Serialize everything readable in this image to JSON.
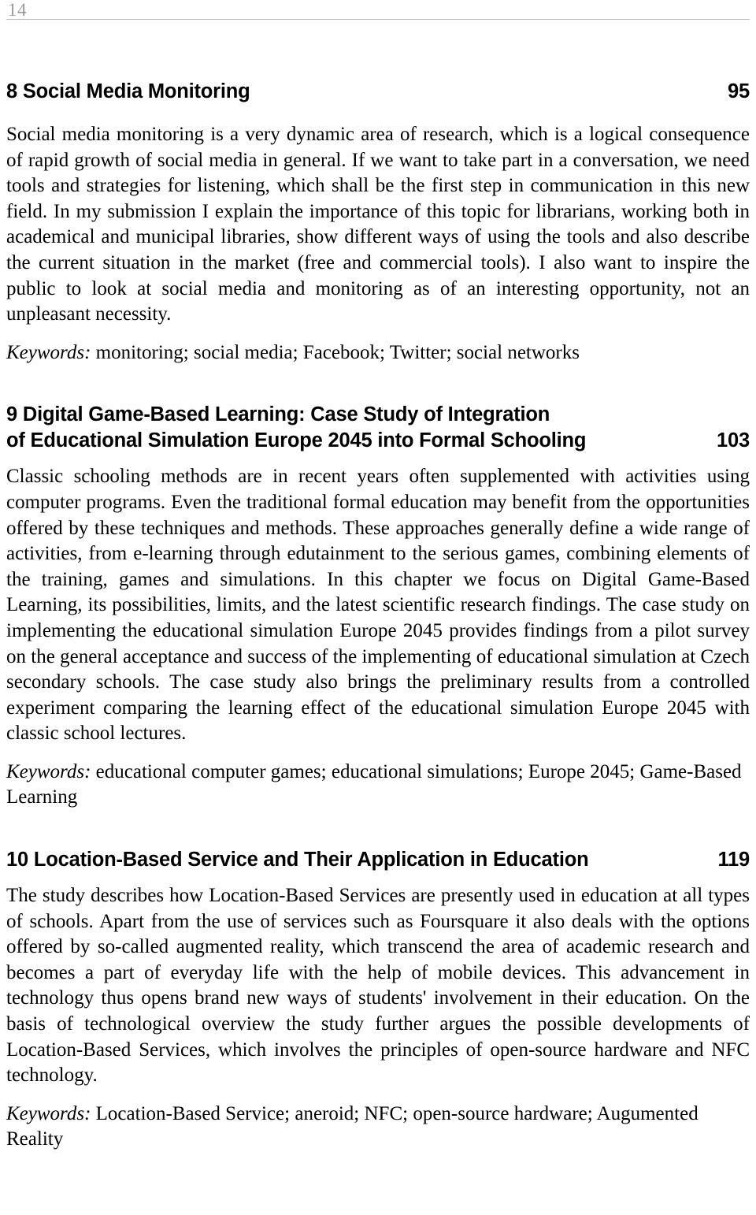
{
  "header": {
    "folio": "14"
  },
  "entries": [
    {
      "id": "social-media-monitoring",
      "number": "8",
      "title_lines": [
        "8 Social Media Monitoring"
      ],
      "page": "95",
      "abstract": "Social media monitoring is a very dynamic area of research, which is a logical consequence of rapid growth of social media in general. If we want to take part in a conversation, we need tools and strategies for listening, which shall be the first step in communication in this new field. In my submission I explain the importance of this topic for librarians, working both in academical and municipal libraries, show different ways of using the tools and also describe the current situation in the market (free and commercial tools). I also want to inspire the public to look at social media and monitoring as of an interesting opportunity, not an unpleasant necessity.",
      "keywords_label": "Keywords:",
      "keywords_text": " monitoring; social media; Facebook; Twitter; social networks"
    },
    {
      "id": "digital-game-based-learning",
      "number": "9",
      "title_lines": [
        "9 Digital Game-Based Learning: Case Study of Integration",
        "of Educational Simulation Europe 2045 into Formal Schooling"
      ],
      "page": "103",
      "abstract": "Classic schooling methods are in recent years often supplemented with activities using computer programs. Even the traditional formal education may benefit from the opportunities offered by these techniques and methods. These approaches generally define a wide range of activities, from e-learning through edutainment to the serious games, combining elements of the training, games and simulations. In this chapter we focus on Digital Game-Based Learning, its possibilities, limits, and the latest scientific research findings. The case study on implementing the educational simulation Europe 2045 provides findings from a pilot survey on the general acceptance and success of the implementing of educational simulation at Czech secondary schools. The case study also brings the preliminary results from a controlled experiment comparing the learning effect of the educational simulation Europe 2045 with classic school lectures.",
      "keywords_label": "Keywords:",
      "keywords_text": " educational computer games; educational simulations; Europe 2045; Game-Based Learning"
    },
    {
      "id": "location-based-service",
      "number": "10",
      "title_lines": [
        "10 Location-Based Service and Their Application in Education"
      ],
      "page": "119",
      "abstract": "The study describes how Location-Based Services are presently used in education at all types of schools. Apart from the use of services such as Foursquare it also deals with the options offered by so-called augmented reality, which transcend the area of academic research and becomes a part of everyday life with the help of mobile devices. This advancement in technology thus opens brand new ways of students' involvement in their education. On the basis of technological overview the study further argues the possible developments of Location-Based Services, which involves the principles of open-source hardware and NFC technology.",
      "keywords_label": "Keywords:",
      "keywords_text": " Location-Based Service; aneroid; NFC; open-source hardware; Augumented Reality"
    }
  ]
}
